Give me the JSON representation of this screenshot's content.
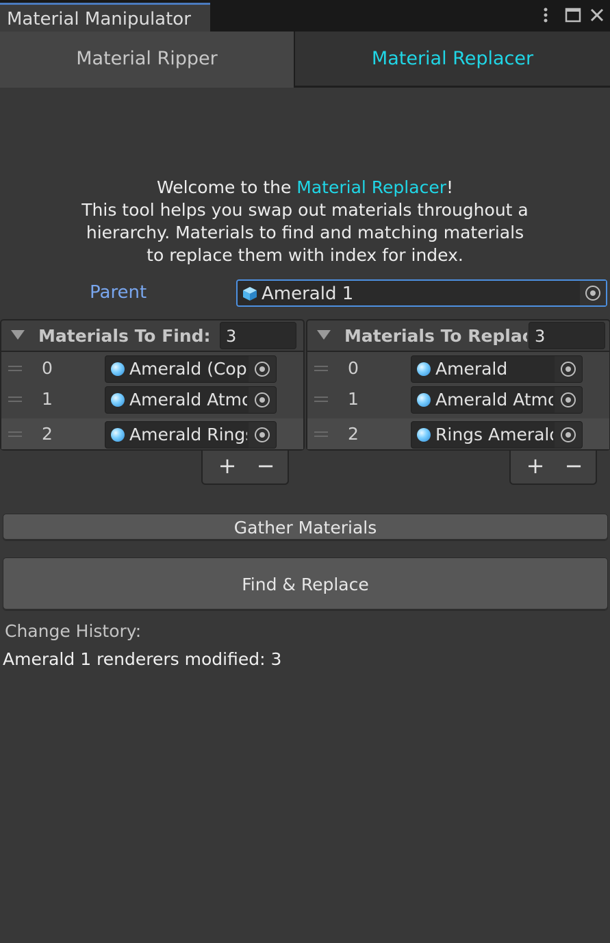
{
  "window": {
    "title": "Material Manipulator",
    "icons": [
      "more-options-icon",
      "maximize-icon",
      "close-icon"
    ]
  },
  "tabs": [
    {
      "label": "Material Ripper",
      "active": false
    },
    {
      "label": "Material Replacer",
      "active": true
    }
  ],
  "welcome": {
    "prefix": "Welcome to the ",
    "highlight": "Material Replacer",
    "suffix": "!",
    "line2": "This tool helps you swap out materials throughout a",
    "line3": "hierarchy. Materials to find and matching materials",
    "line4": "to replace them with index for index."
  },
  "parent": {
    "label": "Parent",
    "value": "Amerald 1"
  },
  "find_list": {
    "title": "Materials To Find:",
    "count": "3",
    "items": [
      {
        "index": "0",
        "value": "Amerald (Cop"
      },
      {
        "index": "1",
        "value": "Amerald Atmo"
      },
      {
        "index": "2",
        "value": "Amerald Rings"
      }
    ],
    "add_label": "+",
    "remove_label": "−"
  },
  "replace_list": {
    "title": "Materials To Replace:",
    "count": "3",
    "items": [
      {
        "index": "0",
        "value": "Amerald"
      },
      {
        "index": "1",
        "value": "Amerald Atmo"
      },
      {
        "index": "2",
        "value": "Rings Amerald"
      }
    ],
    "add_label": "+",
    "remove_label": "−"
  },
  "buttons": {
    "gather": "Gather Materials",
    "find_replace": "Find & Replace"
  },
  "history": {
    "label": "Change History:",
    "entries": [
      "Amerald 1 renderers modified: 3"
    ]
  },
  "colors": {
    "accent": "#20d6e6",
    "parent_label": "#79a6ee",
    "background": "#383838"
  }
}
